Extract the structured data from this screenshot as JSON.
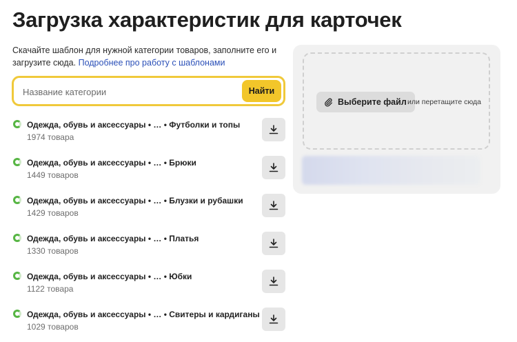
{
  "page": {
    "title": "Загрузка характеристик для карточек",
    "description": "Скачайте шаблон для нужной категории товаров, заполните его и загрузите сюда.",
    "description_link": "Подробнее про работу с шаблонами"
  },
  "search": {
    "placeholder": "Название категории",
    "button_label": "Найти"
  },
  "categories": [
    {
      "path": "Одежда, обувь и аксессуары •  … • Футболки и топы",
      "count": "1974 товара"
    },
    {
      "path": "Одежда, обувь и аксессуары •  … • Брюки",
      "count": "1449 товаров"
    },
    {
      "path": "Одежда, обувь и аксессуары •  … • Блузки и рубашки",
      "count": "1429 товаров"
    },
    {
      "path": "Одежда, обувь и аксессуары •  … • Платья",
      "count": "1330 товаров"
    },
    {
      "path": "Одежда, обувь и аксессуары •  … • Юбки",
      "count": "1122 товара"
    },
    {
      "path": "Одежда, обувь и аксессуары •  … • Свитеры и кардиганы",
      "count": "1029 товаров"
    }
  ],
  "upload": {
    "button_label": "Выберите файл",
    "hint": "или перетащите сюда"
  },
  "colors": {
    "accent": "#f2c62a",
    "link": "#2b50b8",
    "status": "#56b543"
  },
  "icons": {
    "status": "status-ring-icon",
    "download": "download-icon",
    "attach": "paperclip-icon"
  }
}
